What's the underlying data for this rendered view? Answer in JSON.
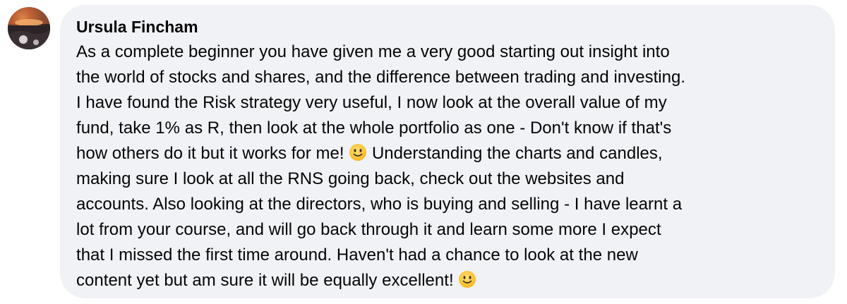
{
  "comment": {
    "author": "Ursula Fincham",
    "lines": [
      "As a complete beginner you have given me a very good starting out insight into",
      "the world of stocks and shares, and the difference between trading and investing.",
      "I have found the Risk strategy very useful, I now look at the overall value of my",
      "fund, take 1% as R, then look at the whole portfolio as one - Don't know if that's",
      "how others do it but it works for me!",
      " Understanding the charts and candles,",
      "making sure I look at all the RNS going back, check out the websites and",
      "accounts. Also looking at the directors, who is buying and selling - I have learnt a",
      "lot from your course, and will go back through it and learn some more I expect",
      "that I missed the first time around. Haven't had a chance to look at the new",
      "content yet but am sure it will be equally excellent!"
    ],
    "emoji_icon": "slightly-smiling-face-icon"
  }
}
